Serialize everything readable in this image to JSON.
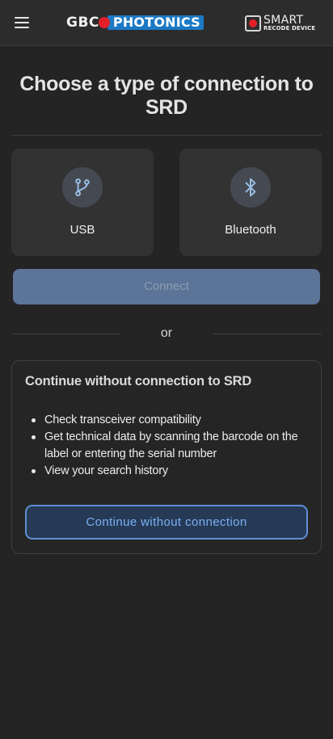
{
  "header": {
    "logo_gbc": "GBC",
    "logo_photonics": "PHOTONICS",
    "srd_logo_main": "SMART",
    "srd_logo_sub": "RECODE DEVICE"
  },
  "main": {
    "title": "Choose a type of connection to SRD",
    "options": [
      {
        "label": "USB",
        "icon": "usb-fork-icon"
      },
      {
        "label": "Bluetooth",
        "icon": "bluetooth-icon"
      }
    ],
    "connect_label": "Connect",
    "divider_text": "or"
  },
  "offline_panel": {
    "title": "Continue without connection to SRD",
    "features": [
      "Check transceiver compatibility",
      "Get technical data by scanning the barcode on the label or entering the serial number",
      "View your search history"
    ],
    "button_label": "Continue without connection"
  },
  "colors": {
    "background": "#242424",
    "brand_blue": "#1b79c5",
    "brand_red": "#e3202a",
    "connect_disabled": "#5b7498",
    "accent_outline": "#5f8fd2"
  }
}
